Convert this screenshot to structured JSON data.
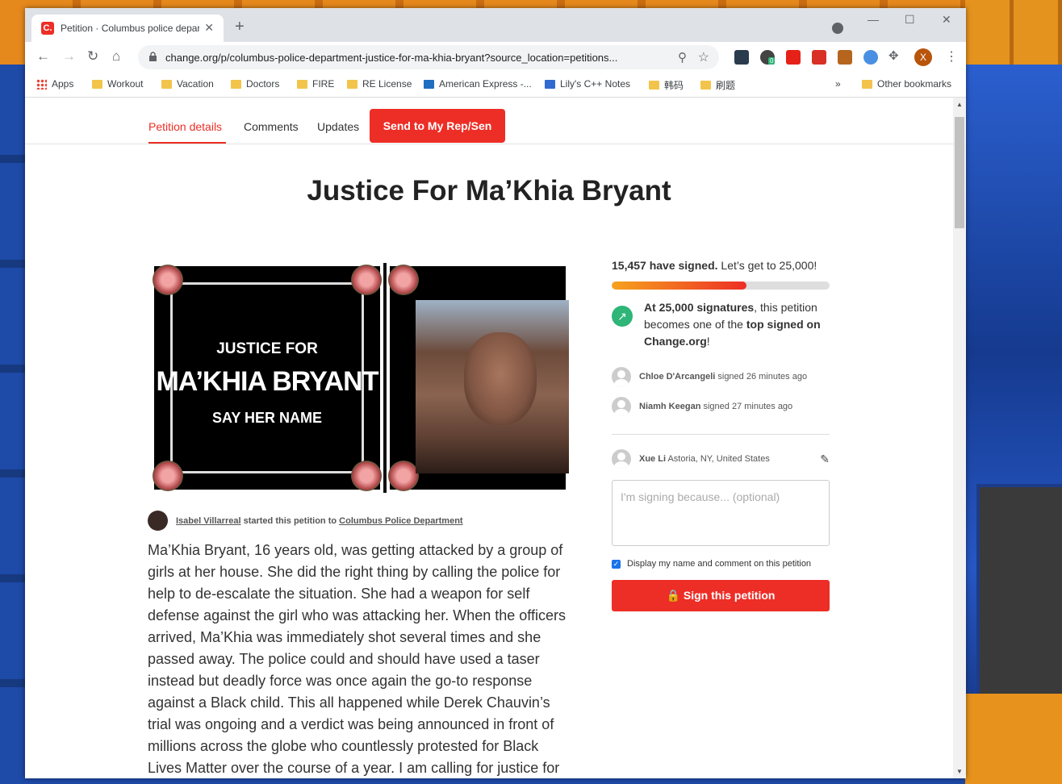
{
  "browser": {
    "tab_title": "Petition · Columbus police department - justice for Ma'Khia Bryant",
    "favicon_text": "C.",
    "url": "change.org/p/columbus-police-department-justice-for-ma-khia-bryant?source_location=petitions...",
    "profile_initial": "X",
    "extension_badge": "0",
    "bookmarks": [
      "Apps",
      "Workout",
      "Vacation",
      "Doctors",
      "FIRE",
      "RE License",
      "American Express -...",
      "Lily's C++ Notes",
      "韩码",
      "刷题"
    ],
    "other_bookmarks": "Other bookmarks",
    "more_bookmarks": "»"
  },
  "subnav": {
    "details": "Petition details",
    "comments": "Comments",
    "updates": "Updates",
    "send_button": "Send to My Rep/Sen"
  },
  "petition": {
    "title": "Justice For Ma’Khia Bryant",
    "image_text": {
      "line1": "JUSTICE FOR",
      "line2": "MA’KHIA BRYANT",
      "line3": "SAY HER NAME"
    },
    "starter_name": "Isabel Villarreal",
    "starter_mid": "started this petition to",
    "target": "Columbus Police Department",
    "body": "Ma’Khia Bryant, 16 years old, was getting attacked by a group of girls at her house. She did the right thing by calling the police for help to de-escalate the situation. She had a weapon for self defense against the girl who was attacking her. When the officers arrived, Ma’Khia was immediately shot several times and she passed away. The police could and should have used a taser instead but deadly force was once again the go-to response against a Black child. This all happened while Derek Chauvin’s trial was ongoing and a verdict was being announced in front of millions across the globe who countlessly protested for Black Lives Matter over the course of a year. I am calling for justice for"
  },
  "sign": {
    "signed_count": "15,457 have signed.",
    "goal_text": "Let’s get to 25,000!",
    "progress_fraction": 0.62,
    "milestone_bold": "At 25,000 signatures",
    "milestone_mid": ", this petition becomes one of the",
    "milestone_bold2": "top signed on Change.org",
    "milestone_end": "!",
    "recent": [
      {
        "name": "Chloe D'Arcangeli",
        "action": "signed 26 minutes ago"
      },
      {
        "name": "Niamh Keegan",
        "action": "signed 27 minutes ago"
      }
    ],
    "me_name": "Xue Li",
    "me_location": "Astoria, NY, United States",
    "textarea_placeholder": "I'm signing because... (optional)",
    "display_label": "Display my name and comment on this petition",
    "sign_button": "Sign this petition"
  }
}
